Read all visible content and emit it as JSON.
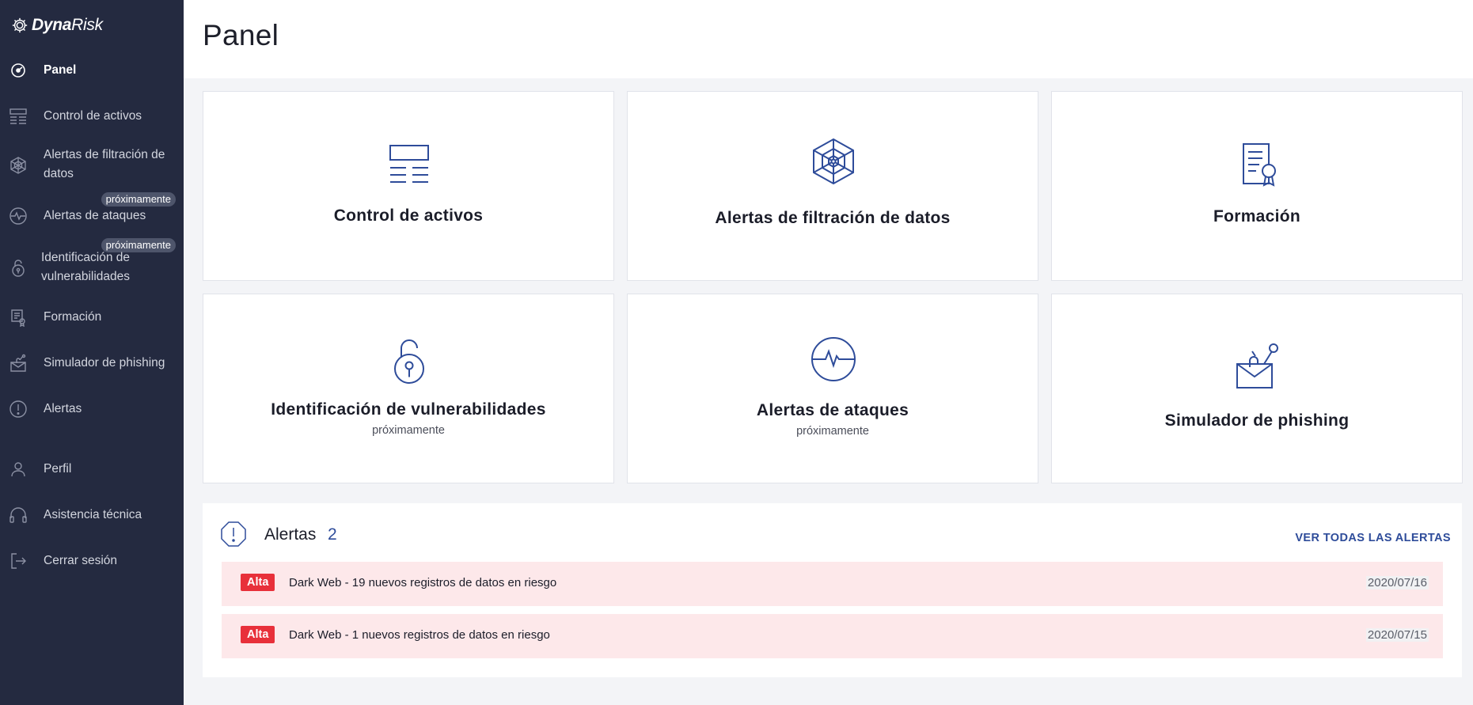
{
  "brand": {
    "name_bold": "Dyna",
    "name_light": "Risk",
    "logo_icon": "gear-icon"
  },
  "sidebar": {
    "items": [
      {
        "label": "Panel",
        "icon": "dashboard-icon",
        "active": true
      },
      {
        "label": "Control de activos",
        "icon": "asset-list-icon"
      },
      {
        "label": "Alertas de filtración de datos",
        "icon": "spiderweb-icon"
      },
      {
        "label": "Alertas de ataques",
        "icon": "pulse-icon",
        "badge": "próximamente"
      },
      {
        "label": "Identificación de vulnerabilidades",
        "icon": "padlock-icon",
        "badge": "próximamente"
      },
      {
        "label": "Formación",
        "icon": "certificate-icon"
      },
      {
        "label": "Simulador de phishing",
        "icon": "phishing-icon"
      },
      {
        "label": "Alertas",
        "icon": "alert-circle-icon"
      },
      {
        "label": "Perfil",
        "icon": "user-icon"
      },
      {
        "label": "Asistencia técnica",
        "icon": "headset-icon"
      },
      {
        "label": "Cerrar sesión",
        "icon": "logout-icon"
      }
    ]
  },
  "header": {
    "title": "Panel"
  },
  "cards": [
    {
      "title": "Control de activos",
      "icon": "asset-list-icon"
    },
    {
      "title": "Alertas de filtración de datos",
      "icon": "spiderweb-icon"
    },
    {
      "title": "Formación",
      "icon": "certificate-icon"
    },
    {
      "title": "Identificación de vulnerabilidades",
      "subtitle": "próximamente",
      "icon": "padlock-icon"
    },
    {
      "title": "Alertas de ataques",
      "subtitle": "próximamente",
      "icon": "pulse-icon"
    },
    {
      "title": "Simulador de phishing",
      "icon": "phishing-icon"
    }
  ],
  "alerts": {
    "title": "Alertas",
    "count": "2",
    "view_all": "VER TODAS LAS ALERTAS",
    "items": [
      {
        "severity": "Alta",
        "text": "Dark Web - 19 nuevos registros de datos en riesgo",
        "date": "2020/07/16"
      },
      {
        "severity": "Alta",
        "text": "Dark Web - 1 nuevos registros de datos en riesgo",
        "date": "2020/07/15"
      }
    ]
  },
  "colors": {
    "sidebar_bg": "#242a40",
    "accent": "#2e4c9a",
    "alert_bg": "#fde8ea",
    "badge_red": "#e8303a"
  }
}
